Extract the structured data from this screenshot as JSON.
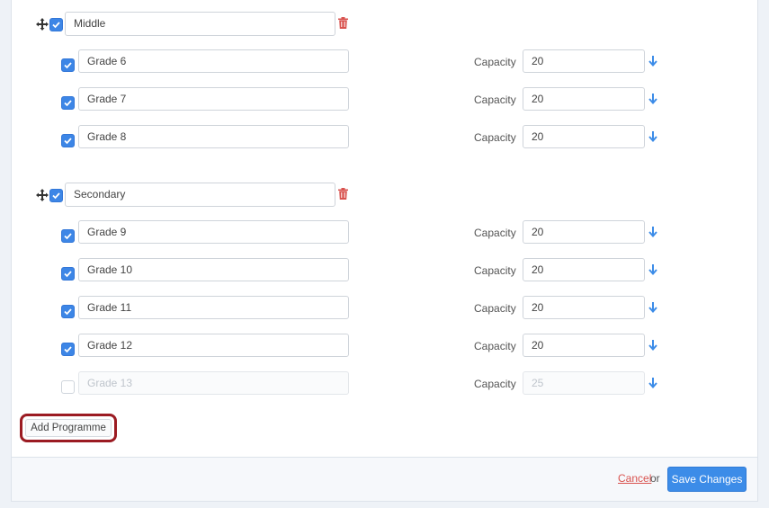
{
  "colors": {
    "accent": "#3c8ce8",
    "danger": "#d9534f",
    "highlight": "#9b1b22"
  },
  "groups": [
    {
      "name": "Middle",
      "checked": true,
      "grades": [
        {
          "name": "Grade 6",
          "capacity_label": "Capacity",
          "capacity": "20",
          "checked": true
        },
        {
          "name": "Grade 7",
          "capacity_label": "Capacity",
          "capacity": "20",
          "checked": true
        },
        {
          "name": "Grade 8",
          "capacity_label": "Capacity",
          "capacity": "20",
          "checked": true
        }
      ]
    },
    {
      "name": "Secondary",
      "checked": true,
      "grades": [
        {
          "name": "Grade 9",
          "capacity_label": "Capacity",
          "capacity": "20",
          "checked": true
        },
        {
          "name": "Grade 10",
          "capacity_label": "Capacity",
          "capacity": "20",
          "checked": true
        },
        {
          "name": "Grade 11",
          "capacity_label": "Capacity",
          "capacity": "20",
          "checked": true
        },
        {
          "name": "Grade 12",
          "capacity_label": "Capacity",
          "capacity": "20",
          "checked": true
        },
        {
          "name": "Grade 13",
          "capacity_label": "Capacity",
          "capacity": "25",
          "checked": false
        }
      ]
    }
  ],
  "actions": {
    "add_programme": "Add Programme",
    "cancel": "Cancel",
    "or": "or",
    "save": "Save Changes"
  },
  "icons": {
    "move": "move-icon",
    "trash": "trash-icon",
    "arrow": "arrow-down-icon",
    "check": "check-icon"
  }
}
